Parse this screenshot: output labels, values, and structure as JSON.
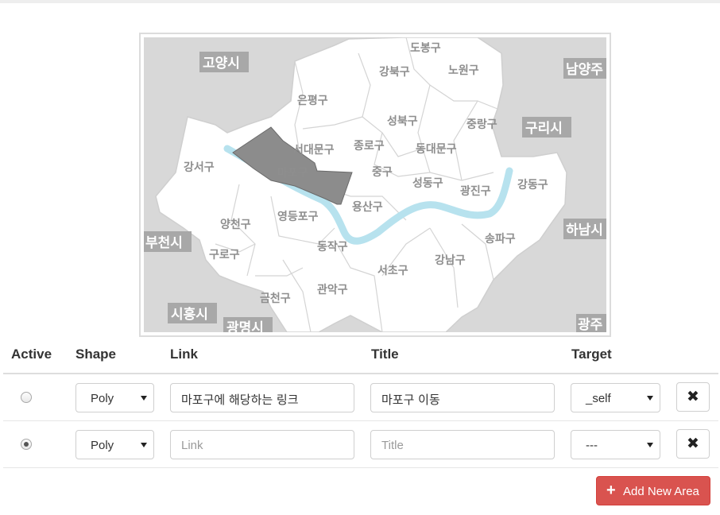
{
  "map": {
    "districts": [
      "도봉구",
      "강북구",
      "노원구",
      "은평구",
      "성북구",
      "중랑구",
      "종로구",
      "동대문구",
      "서대문구",
      "마포구",
      "중구",
      "강서구",
      "성동구",
      "광진구",
      "강동구",
      "용산구",
      "양천구",
      "영등포구",
      "구로구",
      "동작구",
      "서초구",
      "강남구",
      "송파구",
      "관악구",
      "금천구"
    ],
    "cities": [
      "고양시",
      "남양주",
      "구리시",
      "부천시",
      "하남시",
      "시흥시",
      "광명시",
      "광주"
    ],
    "selected_area": "마포구"
  },
  "table": {
    "headers": {
      "active": "Active",
      "shape": "Shape",
      "link": "Link",
      "title": "Title",
      "target": "Target"
    },
    "rows": [
      {
        "active": false,
        "shape": "Poly",
        "link": "마포구에 해당하는 링크",
        "link_placeholder": "Link",
        "title": "마포구 이동",
        "title_placeholder": "Title",
        "target": "_self",
        "delete_icon": "✖"
      },
      {
        "active": true,
        "shape": "Poly",
        "link": "",
        "link_placeholder": "Link",
        "title": "",
        "title_placeholder": "Title",
        "target": "---",
        "delete_icon": "✖"
      }
    ]
  },
  "add_button": {
    "icon": "+",
    "label": "Add New Area",
    "color": "#d9534f"
  }
}
